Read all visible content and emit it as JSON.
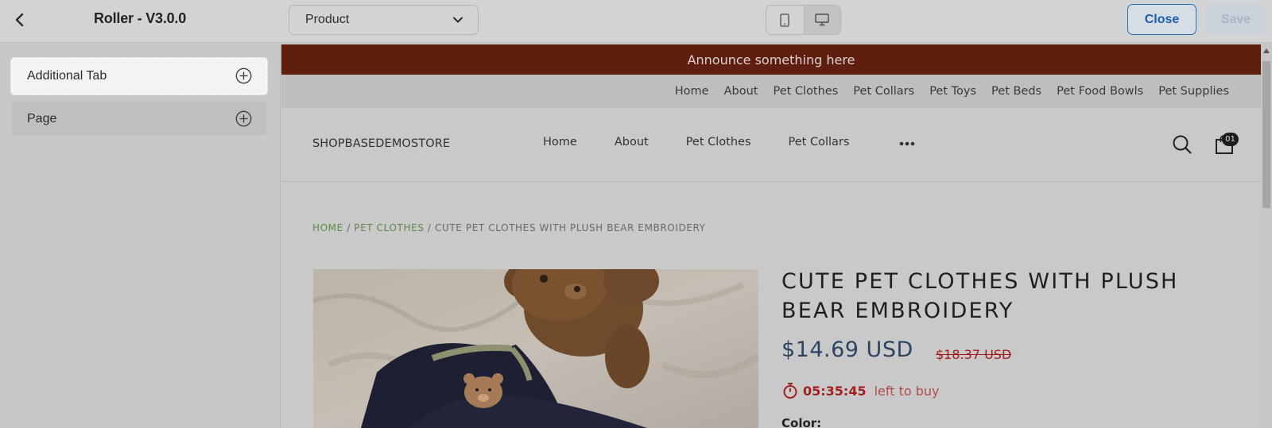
{
  "editor": {
    "app_title": "Roller - V3.0.0",
    "page_select_value": "Product",
    "close_label": "Close",
    "save_label": "Save"
  },
  "sidebar": {
    "items": [
      {
        "label": "Additional Tab"
      },
      {
        "label": "Page"
      }
    ]
  },
  "store": {
    "announcement": "Announce something here",
    "top_links": [
      "Home",
      "About",
      "Pet Clothes",
      "Pet Collars",
      "Pet Toys",
      "Pet Beds",
      "Pet Food Bowls",
      "Pet Supplies"
    ],
    "logo_text": "SHOPBASEDEMOSTORE",
    "main_nav": [
      "Home",
      "About",
      "Pet Clothes",
      "Pet Collars"
    ],
    "cart_count": "01",
    "breadcrumb": {
      "home": "HOME",
      "sep1": " / ",
      "category": "PET CLOTHES",
      "sep2": " / ",
      "current": "CUTE PET CLOTHES WITH PLUSH BEAR EMBROIDERY"
    },
    "product": {
      "title": "CUTE PET CLOTHES WITH PLUSH BEAR EMBROIDERY",
      "price": "$14.69 USD",
      "compare_price": "$18.37 USD",
      "timer": "05:35:45",
      "timer_suffix": "left to buy",
      "color_label": "Color:"
    }
  },
  "colors": {
    "announcement_bg": "#5e1f0f",
    "breadcrumb_link": "#5d8a48",
    "price": "#2a4563",
    "sale_red": "#a31c1c",
    "close_blue": "#1d5fa8"
  }
}
